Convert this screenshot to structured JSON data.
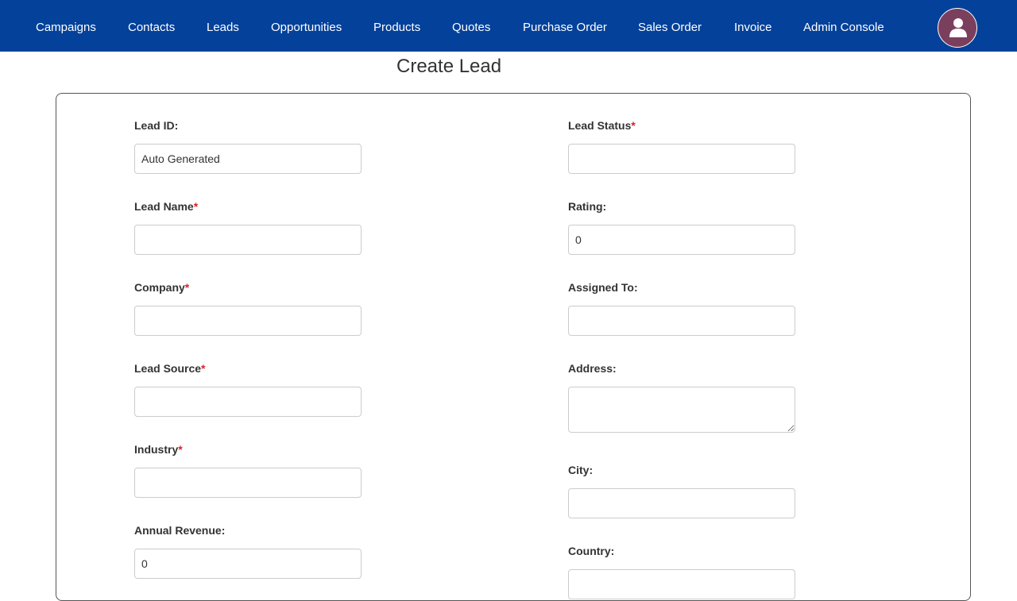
{
  "nav": {
    "items": [
      {
        "label": "Campaigns"
      },
      {
        "label": "Contacts"
      },
      {
        "label": "Leads"
      },
      {
        "label": "Opportunities"
      },
      {
        "label": "Products"
      },
      {
        "label": "Quotes"
      },
      {
        "label": "Purchase Order"
      },
      {
        "label": "Sales Order"
      },
      {
        "label": "Invoice"
      },
      {
        "label": "Admin Console"
      }
    ],
    "avatar_icon": "user-icon",
    "bg_color": "#03419a",
    "avatar_color": "#7b3f5e"
  },
  "page": {
    "title": "Create Lead"
  },
  "form": {
    "required_marker": "*",
    "left": {
      "lead_id": {
        "label": "Lead ID:",
        "value": "Auto Generated"
      },
      "lead_name": {
        "label": "Lead Name",
        "value": ""
      },
      "company": {
        "label": "Company",
        "value": ""
      },
      "lead_source": {
        "label": "Lead Source",
        "value": ""
      },
      "industry": {
        "label": "Industry",
        "value": ""
      },
      "annual_revenue": {
        "label": "Annual Revenue:",
        "value": "0"
      }
    },
    "right": {
      "lead_status": {
        "label": "Lead Status",
        "value": ""
      },
      "rating": {
        "label": "Rating:",
        "value": "0"
      },
      "assigned_to": {
        "label": "Assigned To:",
        "value": ""
      },
      "address": {
        "label": "Address:",
        "value": ""
      },
      "city": {
        "label": "City:",
        "value": ""
      },
      "country": {
        "label": "Country:",
        "value": ""
      }
    }
  }
}
